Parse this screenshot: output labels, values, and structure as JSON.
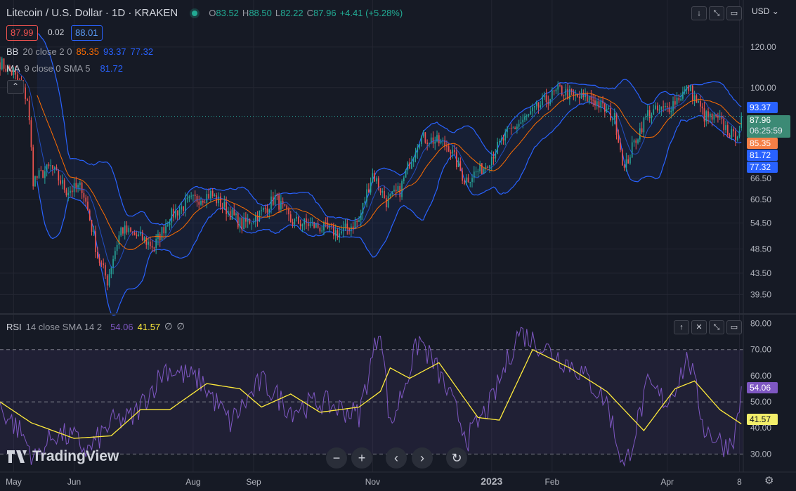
{
  "header": {
    "symbol": "Litecoin / U.S. Dollar · 1D · KRAKEN",
    "o_label": "O",
    "o_value": "83.52",
    "h_label": "H",
    "h_value": "88.50",
    "l_label": "L",
    "l_value": "82.22",
    "c_label": "C",
    "c_value": "87.96",
    "change": "+4.41 (+5.28%)",
    "currency": "USD"
  },
  "order": {
    "sell_price": "87.99",
    "spread": "0.02",
    "buy_price": "88.01"
  },
  "indicators": {
    "bb": {
      "name": "BB",
      "params": "20 close 2 0",
      "basis": "85.35",
      "upper": "93.37",
      "lower": "77.32"
    },
    "ma": {
      "name": "MA",
      "params": "9 close 0 SMA 5",
      "value": "81.72"
    },
    "rsi": {
      "name": "RSI",
      "params": "14 close SMA 14 2",
      "value": "54.06",
      "sma": "41.57",
      "extra1": "∅",
      "extra2": "∅"
    }
  },
  "price_axis_tags": {
    "bb_upper": "93.37",
    "last_price": "87.96",
    "countdown": "06:25:59",
    "bb_basis": "85.35",
    "ma": "81.72",
    "bb_lower": "77.32"
  },
  "rsi_axis_tags": {
    "rsi": "54.06",
    "sma": "41.57"
  },
  "branding": {
    "logo_text": "TradingView"
  },
  "colors": {
    "background": "#161a25",
    "up": "#26a69a",
    "down": "#ef5350",
    "bb_band": "#2962ff",
    "bb_basis": "#ff6d00",
    "rsi": "#7e57c2",
    "rsi_sma": "#ffeb3b",
    "rsi_zone": "#7e57c2",
    "grid": "#232632"
  },
  "chart_data": [
    {
      "type": "candlestick",
      "title": "Litecoin / U.S. Dollar · 1D · KRAKEN",
      "y_scale": "log",
      "y_ticks": [
        39.5,
        43.5,
        48.5,
        54.5,
        60.5,
        66.5,
        100,
        120
      ],
      "y_tick_labels": [
        "39.50",
        "43.50",
        "48.50",
        "54.50",
        "60.50",
        "66.50",
        "100.00",
        "120.00"
      ],
      "x_tick_labels": [
        "May",
        "Jun",
        "Aug",
        "Sep",
        "Nov",
        "2023",
        "Feb",
        "Apr",
        "8"
      ],
      "x_tick_dates": [
        "2022-05-01",
        "2022-06-01",
        "2022-08-01",
        "2022-09-01",
        "2022-11-01",
        "2023-01-01",
        "2023-02-01",
        "2023-04-01",
        "2023-05-08"
      ],
      "x_range": [
        "2022-04-24",
        "2023-05-10"
      ],
      "y_range": [
        37.5,
        140
      ],
      "grid": true,
      "last": {
        "open": 83.52,
        "high": 88.5,
        "low": 82.22,
        "close": 87.96
      },
      "close_path": [
        {
          "date": "2022-04-24",
          "close": 112
        },
        {
          "date": "2022-05-01",
          "close": 106
        },
        {
          "date": "2022-05-08",
          "close": 95
        },
        {
          "date": "2022-05-11",
          "close": 66
        },
        {
          "date": "2022-05-20",
          "close": 70
        },
        {
          "date": "2022-05-28",
          "close": 63
        },
        {
          "date": "2022-06-05",
          "close": 64
        },
        {
          "date": "2022-06-13",
          "close": 47
        },
        {
          "date": "2022-06-18",
          "close": 42
        },
        {
          "date": "2022-06-25",
          "close": 53
        },
        {
          "date": "2022-07-05",
          "close": 51
        },
        {
          "date": "2022-07-12",
          "close": 49
        },
        {
          "date": "2022-07-20",
          "close": 56
        },
        {
          "date": "2022-07-30",
          "close": 60
        },
        {
          "date": "2022-08-10",
          "close": 62
        },
        {
          "date": "2022-08-18",
          "close": 58
        },
        {
          "date": "2022-08-26",
          "close": 54
        },
        {
          "date": "2022-09-05",
          "close": 57
        },
        {
          "date": "2022-09-12",
          "close": 61
        },
        {
          "date": "2022-09-20",
          "close": 55
        },
        {
          "date": "2022-10-01",
          "close": 54
        },
        {
          "date": "2022-10-15",
          "close": 52
        },
        {
          "date": "2022-10-25",
          "close": 55
        },
        {
          "date": "2022-11-01",
          "close": 68
        },
        {
          "date": "2022-11-08",
          "close": 60
        },
        {
          "date": "2022-11-15",
          "close": 63
        },
        {
          "date": "2022-11-25",
          "close": 80
        },
        {
          "date": "2022-12-02",
          "close": 79
        },
        {
          "date": "2022-12-10",
          "close": 77
        },
        {
          "date": "2022-12-18",
          "close": 66
        },
        {
          "date": "2022-12-28",
          "close": 70
        },
        {
          "date": "2023-01-10",
          "close": 82
        },
        {
          "date": "2023-01-20",
          "close": 88
        },
        {
          "date": "2023-01-28",
          "close": 94
        },
        {
          "date": "2023-02-05",
          "close": 99
        },
        {
          "date": "2023-02-12",
          "close": 96
        },
        {
          "date": "2023-02-22",
          "close": 95
        },
        {
          "date": "2023-03-05",
          "close": 87
        },
        {
          "date": "2023-03-10",
          "close": 69
        },
        {
          "date": "2023-03-15",
          "close": 78
        },
        {
          "date": "2023-03-22",
          "close": 89
        },
        {
          "date": "2023-04-01",
          "close": 91
        },
        {
          "date": "2023-04-12",
          "close": 100
        },
        {
          "date": "2023-04-20",
          "close": 88
        },
        {
          "date": "2023-04-28",
          "close": 86
        },
        {
          "date": "2023-05-05",
          "close": 80
        },
        {
          "date": "2023-05-08",
          "close": 83.52
        },
        {
          "date": "2023-05-09",
          "close": 87.96
        }
      ],
      "series": [
        {
          "name": "BB",
          "basis": 85.35,
          "upper": 93.37,
          "lower": 77.32
        },
        {
          "name": "MA",
          "value": 81.72
        }
      ]
    },
    {
      "type": "line",
      "title": "RSI",
      "y_ticks": [
        30,
        40,
        50,
        60,
        70,
        80
      ],
      "y_tick_labels": [
        "30.00",
        "40.00",
        "50.00",
        "60.00",
        "70.00",
        "80.00"
      ],
      "y_range": [
        25,
        81.5
      ],
      "bands": {
        "upper": 70,
        "middle": 50,
        "lower": 30
      },
      "rsi_path": [
        {
          "date": "2022-04-24",
          "value": 48
        },
        {
          "date": "2022-05-05",
          "value": 38
        },
        {
          "date": "2022-05-12",
          "value": 28
        },
        {
          "date": "2022-05-22",
          "value": 38
        },
        {
          "date": "2022-06-01",
          "value": 36
        },
        {
          "date": "2022-06-08",
          "value": 31
        },
        {
          "date": "2022-06-20",
          "value": 42
        },
        {
          "date": "2022-07-01",
          "value": 44
        },
        {
          "date": "2022-07-18",
          "value": 63
        },
        {
          "date": "2022-08-05",
          "value": 58
        },
        {
          "date": "2022-08-20",
          "value": 42
        },
        {
          "date": "2022-09-05",
          "value": 58
        },
        {
          "date": "2022-09-20",
          "value": 47
        },
        {
          "date": "2022-10-05",
          "value": 50
        },
        {
          "date": "2022-10-25",
          "value": 45
        },
        {
          "date": "2022-11-05",
          "value": 80
        },
        {
          "date": "2022-11-10",
          "value": 40
        },
        {
          "date": "2022-11-25",
          "value": 74
        },
        {
          "date": "2022-12-05",
          "value": 61
        },
        {
          "date": "2022-12-20",
          "value": 36
        },
        {
          "date": "2023-01-01",
          "value": 50
        },
        {
          "date": "2023-01-15",
          "value": 77
        },
        {
          "date": "2023-02-01",
          "value": 69
        },
        {
          "date": "2023-02-15",
          "value": 62
        },
        {
          "date": "2023-03-01",
          "value": 50
        },
        {
          "date": "2023-03-10",
          "value": 24
        },
        {
          "date": "2023-03-22",
          "value": 56
        },
        {
          "date": "2023-04-01",
          "value": 50
        },
        {
          "date": "2023-04-12",
          "value": 67
        },
        {
          "date": "2023-04-20",
          "value": 40
        },
        {
          "date": "2023-05-01",
          "value": 33
        },
        {
          "date": "2023-05-06",
          "value": 38
        },
        {
          "date": "2023-05-09",
          "value": 54.06
        }
      ],
      "sma_path": [
        {
          "date": "2022-04-24",
          "value": 50
        },
        {
          "date": "2022-05-10",
          "value": 42
        },
        {
          "date": "2022-06-01",
          "value": 36
        },
        {
          "date": "2022-06-20",
          "value": 37
        },
        {
          "date": "2022-07-05",
          "value": 47
        },
        {
          "date": "2022-07-20",
          "value": 47
        },
        {
          "date": "2022-08-08",
          "value": 57
        },
        {
          "date": "2022-08-25",
          "value": 55
        },
        {
          "date": "2022-09-05",
          "value": 48
        },
        {
          "date": "2022-09-20",
          "value": 53
        },
        {
          "date": "2022-10-05",
          "value": 46
        },
        {
          "date": "2022-10-25",
          "value": 48
        },
        {
          "date": "2022-11-05",
          "value": 54
        },
        {
          "date": "2022-11-10",
          "value": 63
        },
        {
          "date": "2022-11-20",
          "value": 59
        },
        {
          "date": "2022-12-05",
          "value": 65
        },
        {
          "date": "2022-12-25",
          "value": 44
        },
        {
          "date": "2023-01-05",
          "value": 43
        },
        {
          "date": "2023-01-22",
          "value": 70
        },
        {
          "date": "2023-02-10",
          "value": 63
        },
        {
          "date": "2023-03-01",
          "value": 54
        },
        {
          "date": "2023-03-20",
          "value": 39
        },
        {
          "date": "2023-04-05",
          "value": 55
        },
        {
          "date": "2023-04-15",
          "value": 58
        },
        {
          "date": "2023-04-28",
          "value": 47
        },
        {
          "date": "2023-05-09",
          "value": 41.57
        }
      ]
    }
  ]
}
